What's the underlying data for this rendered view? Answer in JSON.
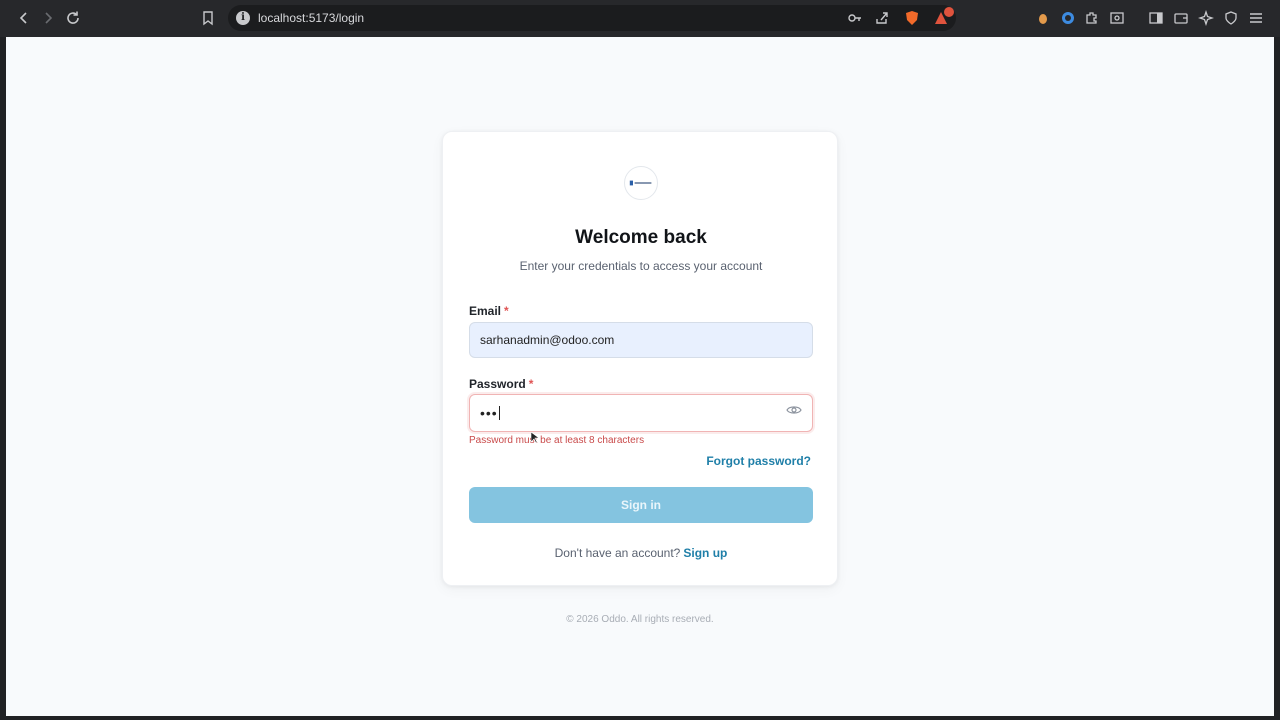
{
  "browser": {
    "url": "localhost:5173/login",
    "accent": "#27282b"
  },
  "login": {
    "logo_text": "",
    "title": "Welcome back",
    "subtitle": "Enter your credentials to access your account",
    "email_label": "Email",
    "email_value": "sarhanadmin@odoo.com",
    "password_label": "Password",
    "password_value": "•••",
    "required_mark": "*",
    "password_error": "Password must be at least 8 characters",
    "forgot_link": "Forgot password?",
    "signin_button": "Sign in",
    "signup_prompt": "Don't have an account?",
    "signup_link": "Sign up"
  },
  "footer": {
    "copyright": "© 2026 Oddo. All rights reserved."
  },
  "colors": {
    "primary": "#84c4e0",
    "link": "#1f7fa8",
    "error": "#c94a4a",
    "background": "#f8fafc"
  }
}
